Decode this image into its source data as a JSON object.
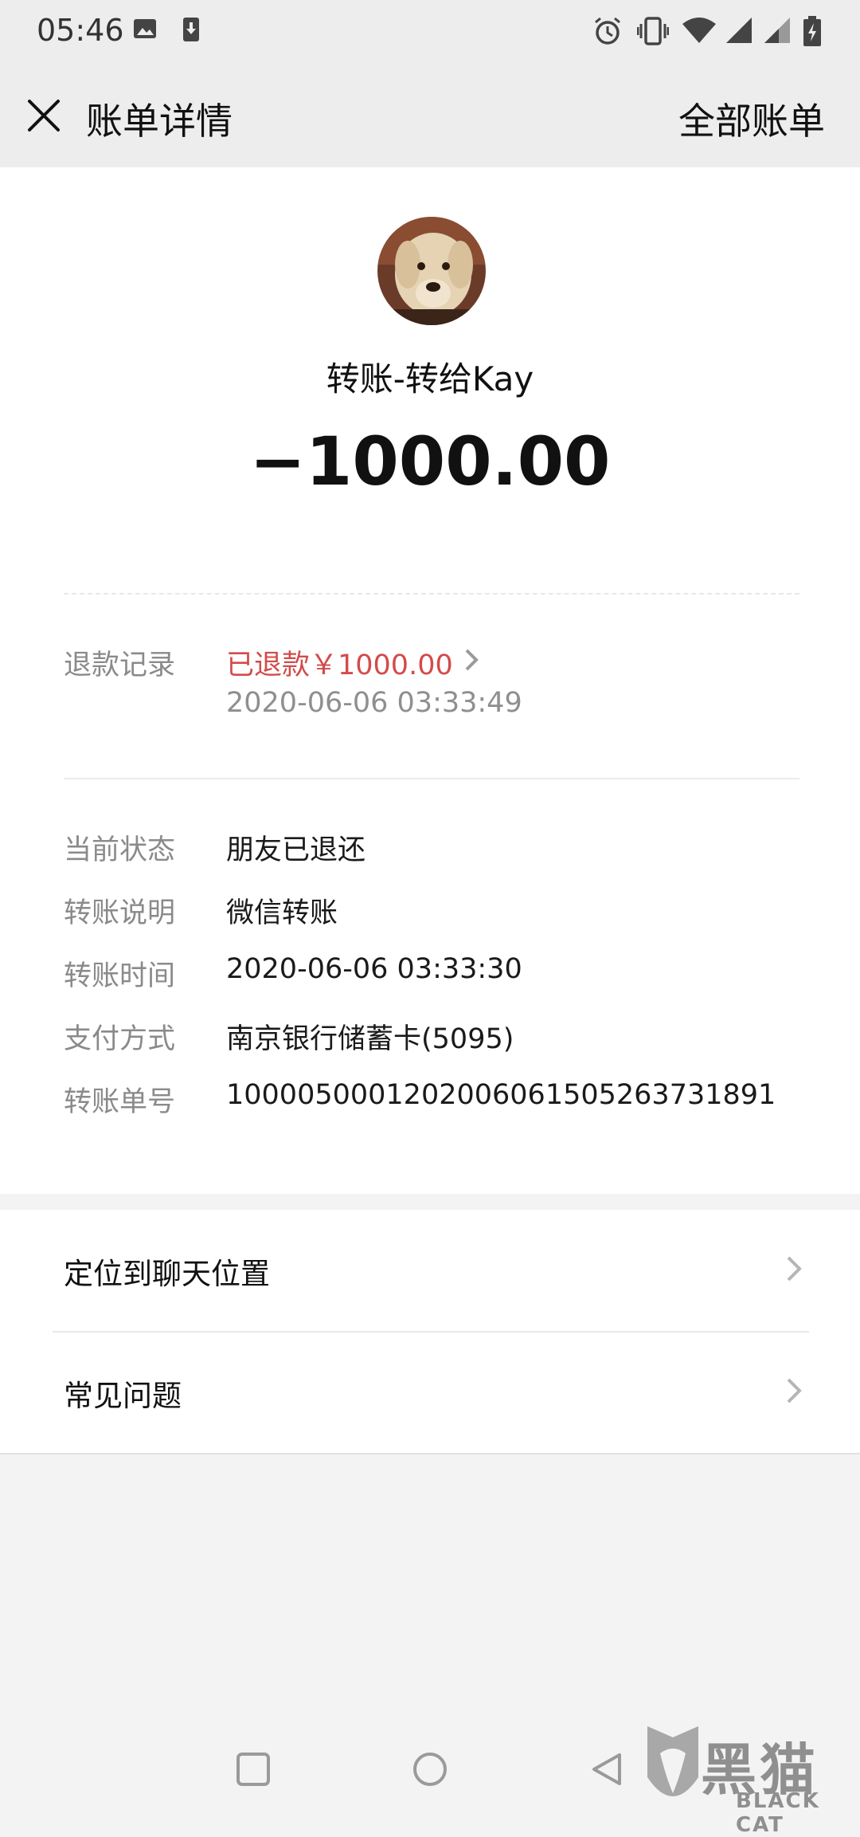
{
  "status_bar": {
    "time": "05:46",
    "icons": [
      "image-icon",
      "download-icon",
      "alarm-icon",
      "vibrate-icon",
      "wifi-icon",
      "signal-icon",
      "signal-icon-2",
      "battery-icon"
    ]
  },
  "header": {
    "close_icon": "close-icon",
    "title": "账单详情",
    "right_action": "全部账单"
  },
  "transaction": {
    "subject": "转账-转给Kay",
    "amount": "−1000.00"
  },
  "refund": {
    "label": "退款记录",
    "status": "已退款￥1000.00",
    "time": "2020-06-06 03:33:49"
  },
  "details": [
    {
      "label": "当前状态",
      "value": "朋友已退还"
    },
    {
      "label": "转账说明",
      "value": "微信转账"
    },
    {
      "label": "转账时间",
      "value": "2020-06-06 03:33:30"
    },
    {
      "label": "支付方式",
      "value": "南京银行储蓄卡(5095)"
    },
    {
      "label": "转账单号",
      "value": "1000050001202006061505263731891"
    }
  ],
  "actions": [
    {
      "label": "定位到聊天位置"
    },
    {
      "label": "常见问题"
    }
  ],
  "watermark": {
    "chinese": "黑猫",
    "english": "BLACK CAT"
  },
  "colors": {
    "refund_red": "#d34b4b",
    "background": "#f3f3f3",
    "navbar": "#ededed"
  }
}
